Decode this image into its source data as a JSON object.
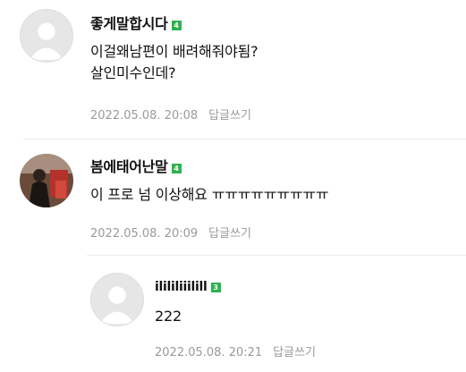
{
  "comments": [
    {
      "nickname": "좋게말합시다",
      "level": "4",
      "text": "이걸왜남편이 배려해줘야됨?\n살인미수인데?",
      "date": "2022.05.08. 20:08",
      "reply_label": "답글쓰기"
    },
    {
      "nickname": "봄에태어난말",
      "level": "4",
      "text": "이 프로 넘 이상해요 ㅠㅠㅠㅠㅠㅠㅠㅠㅠ",
      "date": "2022.05.08. 20:09",
      "reply_label": "답글쓰기"
    },
    {
      "nickname": "ilililiiilill",
      "level": "3",
      "text": "222",
      "date": "2022.05.08. 20:21",
      "reply_label": "답글쓰기"
    }
  ],
  "colors": {
    "level_badge": "#2fb24f",
    "meta_text": "#9a9a9a",
    "divider": "#eeeeee"
  }
}
